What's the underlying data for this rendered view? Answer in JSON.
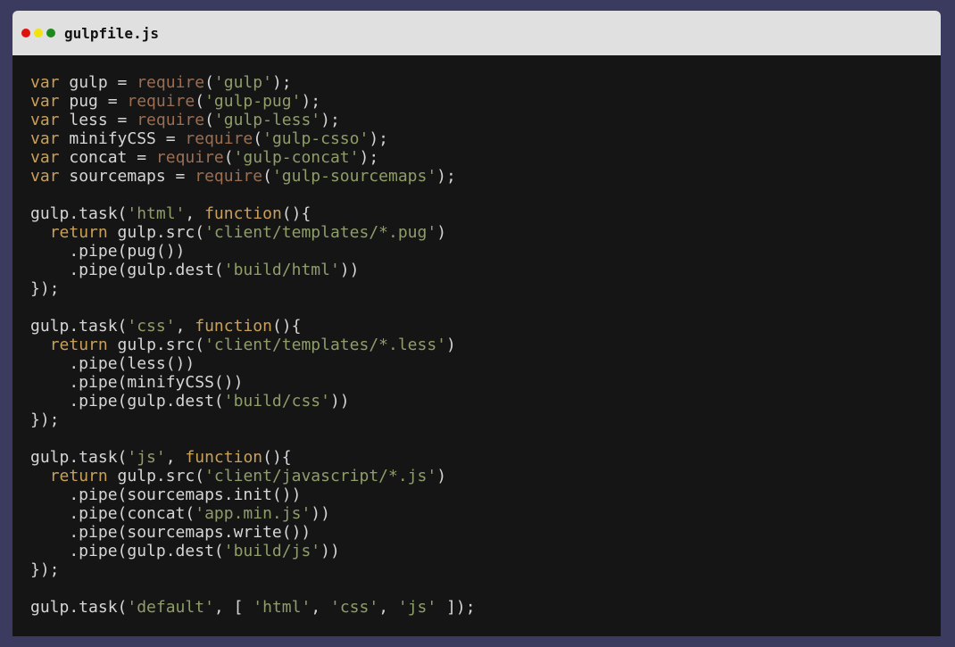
{
  "window": {
    "title": "gulpfile.js",
    "buttons": [
      "close",
      "minimize",
      "maximize"
    ]
  },
  "colors": {
    "background": "#3b3b60",
    "editor": "#151515",
    "titlebar": "#e0e0e0",
    "keyword": "#c9a05a",
    "builtin": "#9b6e52",
    "string": "#8f9d6a",
    "text": "#d6d6d6"
  },
  "code": {
    "lines": [
      [
        [
          "kw",
          "var"
        ],
        [
          "plain",
          " gulp = "
        ],
        [
          "fn",
          "require"
        ],
        [
          "plain",
          "("
        ],
        [
          "str",
          "'gulp'"
        ],
        [
          "plain",
          ");"
        ]
      ],
      [
        [
          "kw",
          "var"
        ],
        [
          "plain",
          " pug = "
        ],
        [
          "fn",
          "require"
        ],
        [
          "plain",
          "("
        ],
        [
          "str",
          "'gulp-pug'"
        ],
        [
          "plain",
          ");"
        ]
      ],
      [
        [
          "kw",
          "var"
        ],
        [
          "plain",
          " less = "
        ],
        [
          "fn",
          "require"
        ],
        [
          "plain",
          "("
        ],
        [
          "str",
          "'gulp-less'"
        ],
        [
          "plain",
          ");"
        ]
      ],
      [
        [
          "kw",
          "var"
        ],
        [
          "plain",
          " minifyCSS = "
        ],
        [
          "fn",
          "require"
        ],
        [
          "plain",
          "("
        ],
        [
          "str",
          "'gulp-csso'"
        ],
        [
          "plain",
          ");"
        ]
      ],
      [
        [
          "kw",
          "var"
        ],
        [
          "plain",
          " concat = "
        ],
        [
          "fn",
          "require"
        ],
        [
          "plain",
          "("
        ],
        [
          "str",
          "'gulp-concat'"
        ],
        [
          "plain",
          ");"
        ]
      ],
      [
        [
          "kw",
          "var"
        ],
        [
          "plain",
          " sourcemaps = "
        ],
        [
          "fn",
          "require"
        ],
        [
          "plain",
          "("
        ],
        [
          "str",
          "'gulp-sourcemaps'"
        ],
        [
          "plain",
          ");"
        ]
      ],
      [],
      [
        [
          "plain",
          "gulp.task("
        ],
        [
          "str",
          "'html'"
        ],
        [
          "plain",
          ", "
        ],
        [
          "kw",
          "function"
        ],
        [
          "plain",
          "(){"
        ]
      ],
      [
        [
          "plain",
          "  "
        ],
        [
          "kw",
          "return"
        ],
        [
          "plain",
          " gulp.src("
        ],
        [
          "str",
          "'client/templates/*.pug'"
        ],
        [
          "plain",
          ")"
        ]
      ],
      [
        [
          "plain",
          "    .pipe(pug())"
        ]
      ],
      [
        [
          "plain",
          "    .pipe(gulp.dest("
        ],
        [
          "str",
          "'build/html'"
        ],
        [
          "plain",
          "))"
        ]
      ],
      [
        [
          "plain",
          "});"
        ]
      ],
      [],
      [
        [
          "plain",
          "gulp.task("
        ],
        [
          "str",
          "'css'"
        ],
        [
          "plain",
          ", "
        ],
        [
          "kw",
          "function"
        ],
        [
          "plain",
          "(){"
        ]
      ],
      [
        [
          "plain",
          "  "
        ],
        [
          "kw",
          "return"
        ],
        [
          "plain",
          " gulp.src("
        ],
        [
          "str",
          "'client/templates/*.less'"
        ],
        [
          "plain",
          ")"
        ]
      ],
      [
        [
          "plain",
          "    .pipe(less())"
        ]
      ],
      [
        [
          "plain",
          "    .pipe(minifyCSS())"
        ]
      ],
      [
        [
          "plain",
          "    .pipe(gulp.dest("
        ],
        [
          "str",
          "'build/css'"
        ],
        [
          "plain",
          "))"
        ]
      ],
      [
        [
          "plain",
          "});"
        ]
      ],
      [],
      [
        [
          "plain",
          "gulp.task("
        ],
        [
          "str",
          "'js'"
        ],
        [
          "plain",
          ", "
        ],
        [
          "kw",
          "function"
        ],
        [
          "plain",
          "(){"
        ]
      ],
      [
        [
          "plain",
          "  "
        ],
        [
          "kw",
          "return"
        ],
        [
          "plain",
          " gulp.src("
        ],
        [
          "str",
          "'client/javascript/*.js'"
        ],
        [
          "plain",
          ")"
        ]
      ],
      [
        [
          "plain",
          "    .pipe(sourcemaps.init())"
        ]
      ],
      [
        [
          "plain",
          "    .pipe(concat("
        ],
        [
          "str",
          "'app.min.js'"
        ],
        [
          "plain",
          "))"
        ]
      ],
      [
        [
          "plain",
          "    .pipe(sourcemaps.write())"
        ]
      ],
      [
        [
          "plain",
          "    .pipe(gulp.dest("
        ],
        [
          "str",
          "'build/js'"
        ],
        [
          "plain",
          "))"
        ]
      ],
      [
        [
          "plain",
          "});"
        ]
      ],
      [],
      [
        [
          "plain",
          "gulp.task("
        ],
        [
          "str",
          "'default'"
        ],
        [
          "plain",
          ", [ "
        ],
        [
          "str",
          "'html'"
        ],
        [
          "plain",
          ", "
        ],
        [
          "str",
          "'css'"
        ],
        [
          "plain",
          ", "
        ],
        [
          "str",
          "'js'"
        ],
        [
          "plain",
          " ]);"
        ]
      ]
    ]
  }
}
